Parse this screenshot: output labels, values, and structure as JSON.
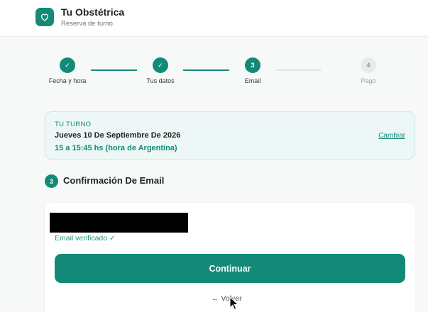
{
  "header": {
    "brand_title": "Tu Obstétrica",
    "brand_subtitle": "Reserva de turno",
    "logo_icon": "heart-icon"
  },
  "stepper": {
    "steps": [
      {
        "label": "Fecha y hora",
        "status": "done",
        "marker": "✓"
      },
      {
        "label": "Tus datos",
        "status": "done",
        "marker": "✓"
      },
      {
        "label": "Email",
        "status": "active",
        "marker": "3"
      },
      {
        "label": "Pago",
        "status": "todo",
        "marker": "4"
      }
    ]
  },
  "turno": {
    "label": "TU TURNO",
    "date": "Jueves 10 De Septiembre De 2026",
    "time": "15 a 15:45 hs (hora de Argentina)",
    "change_label": "Cambiar"
  },
  "section": {
    "number": "3",
    "title": "Confirmación De Email"
  },
  "email": {
    "verified_text": "Email verificado ✓"
  },
  "actions": {
    "continue_label": "Continuar",
    "back_label": "← Volver"
  },
  "colors": {
    "accent": "#138a78",
    "verified": "#1a9a5e"
  }
}
